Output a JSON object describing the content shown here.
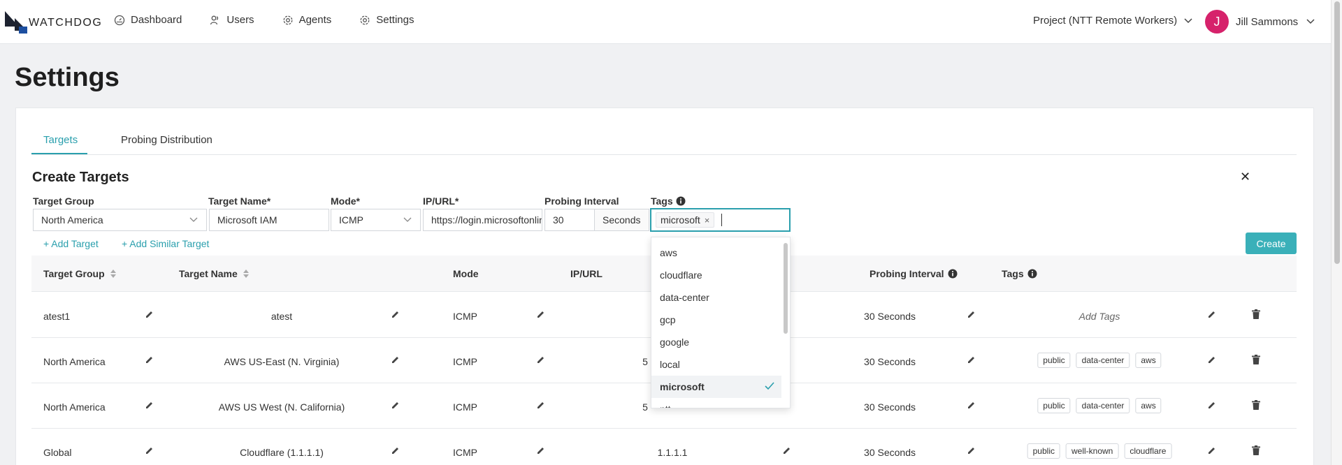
{
  "app": {
    "logo_text": "WATCHDOG",
    "nav": [
      "Dashboard",
      "Users",
      "Agents",
      "Settings"
    ],
    "project": "Project (NTT Remote Workers)",
    "user_initial": "J",
    "user_name": "Jill Sammons"
  },
  "page": {
    "title": "Settings"
  },
  "tabs": [
    "Targets",
    "Probing Distribution"
  ],
  "create": {
    "title": "Create Targets",
    "labels": {
      "target_group": "Target Group",
      "target_name": "Target Name*",
      "mode": "Mode*",
      "ip_url": "IP/URL*",
      "probing_interval": "Probing Interval",
      "tags": "Tags"
    },
    "values": {
      "target_group": "North America",
      "target_name": "Microsoft IAM",
      "mode": "ICMP",
      "ip_url": "https://login.microsoftonline.com",
      "probing_interval": "30",
      "interval_unit": "Seconds",
      "tag": "microsoft"
    },
    "add_target": "+ Add Target",
    "add_similar": "+ Add Similar Target",
    "create_button": "Create"
  },
  "table": {
    "headers": [
      "Target Group",
      "Target Name",
      "Mode",
      "IP/URL",
      "Probing Interval",
      "Tags"
    ],
    "rows": [
      {
        "group": "atest1",
        "name": "atest",
        "mode": "ICMP",
        "ip": "",
        "interval": "30 Seconds",
        "tags": [],
        "add_tags": "Add Tags"
      },
      {
        "group": "North America",
        "name": "AWS US-East (N. Virginia)",
        "mode": "ICMP",
        "ip": "5",
        "interval": "30 Seconds",
        "tags": [
          "public",
          "data-center",
          "aws"
        ]
      },
      {
        "group": "North America",
        "name": "AWS US West (N. California)",
        "mode": "ICMP",
        "ip": "5",
        "interval": "30 Seconds",
        "tags": [
          "public",
          "data-center",
          "aws"
        ]
      },
      {
        "group": "Global",
        "name": "Cloudflare (1.1.1.1)",
        "mode": "ICMP",
        "ip": "1.1.1.1",
        "interval": "30 Seconds",
        "tags": [
          "public",
          "well-known",
          "cloudflare"
        ]
      }
    ]
  },
  "tag_dropdown": {
    "options": [
      "aws",
      "cloudflare",
      "data-center",
      "gcp",
      "google",
      "local",
      "microsoft",
      "ntt"
    ],
    "selected": "microsoft"
  },
  "colors": {
    "accent": "#2a9fad",
    "avatar": "#d6226b",
    "create_button": "#3ab0b9"
  }
}
